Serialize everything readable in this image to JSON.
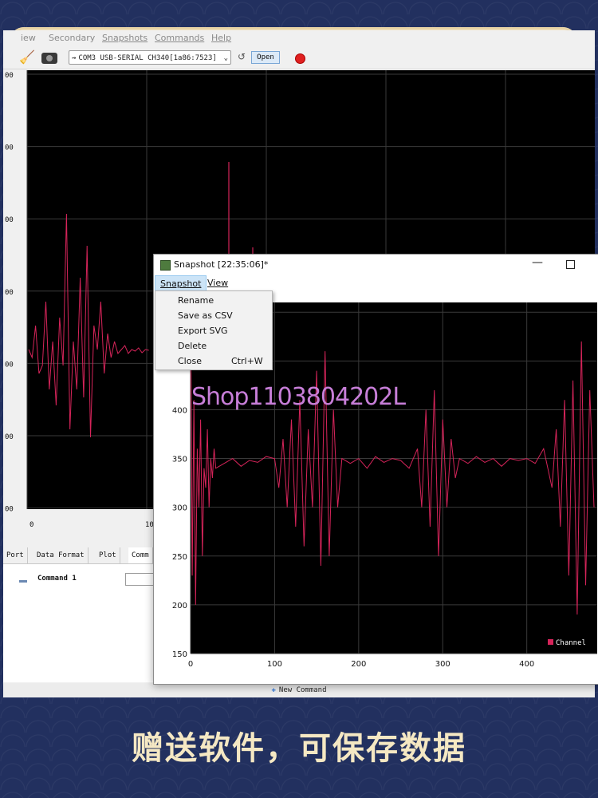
{
  "menubar": {
    "items": [
      "iew",
      "Secondary",
      "Snapshots",
      "Commands",
      "Help"
    ]
  },
  "toolbar": {
    "port": "COM3 USB-SERIAL CH340[1a86:7523]",
    "open_label": "Open",
    "icons": [
      "broom-icon",
      "camera-icon",
      "usb-icon",
      "reload-icon",
      "record-icon"
    ]
  },
  "tabs": [
    "Port",
    "Data Format",
    "Plot",
    "Comm"
  ],
  "command_panel": {
    "command_label": "Command 1",
    "new_command_label": "New Command"
  },
  "snapshot_window": {
    "title": "Snapshot [22:35:06]*",
    "menus": [
      "Snapshot",
      "View"
    ],
    "dropdown_items": [
      {
        "label": "Rename",
        "shortcut": ""
      },
      {
        "label": "Save as CSV",
        "shortcut": ""
      },
      {
        "label": "Export SVG",
        "shortcut": ""
      },
      {
        "label": "Delete",
        "shortcut": ""
      },
      {
        "label": "Close",
        "shortcut": "Ctrl+W"
      }
    ]
  },
  "watermark": "Shop1103804202L",
  "caption": "赠送软件，可保存数据",
  "colors": {
    "plot_bg": "#000000",
    "signal": "#d6245a",
    "grid": "#3a3a3a",
    "background": "#22305f",
    "caption": "#f5e8c3"
  },
  "chart_data": [
    {
      "type": "line",
      "title": "",
      "xlabel": "",
      "ylabel": "",
      "x_ticks": [
        "0",
        "10"
      ],
      "y_ticks": [
        "00",
        "00",
        "00",
        "00",
        "00",
        "00",
        "00"
      ],
      "grid": true,
      "series": [
        {
          "values": [
            350,
            340,
            380,
            320,
            330,
            410,
            300,
            360,
            280,
            390,
            330,
            520,
            250,
            360,
            300,
            440,
            290,
            480,
            240,
            380,
            350,
            410,
            320,
            370,
            340,
            360,
            345,
            350,
            355,
            345,
            350,
            348,
            352,
            346,
            350,
            349
          ]
        }
      ]
    },
    {
      "type": "line",
      "title": "",
      "xlabel": "",
      "ylabel": "",
      "x_ticks": [
        "0",
        "100",
        "200",
        "300",
        "400"
      ],
      "y_ticks": [
        "500",
        "450",
        "400",
        "350",
        "300",
        "250",
        "200",
        "150"
      ],
      "ylim": [
        150,
        510
      ],
      "xlim": [
        0,
        480
      ],
      "grid": true,
      "legend": "bottom-right",
      "series": [
        {
          "name": "Channel",
          "x": [
            0,
            2,
            4,
            6,
            8,
            10,
            12,
            14,
            16,
            18,
            20,
            22,
            24,
            26,
            28,
            30,
            40,
            50,
            60,
            70,
            80,
            90,
            100,
            105,
            110,
            115,
            120,
            125,
            130,
            135,
            140,
            145,
            150,
            155,
            160,
            165,
            170,
            175,
            180,
            190,
            200,
            210,
            220,
            230,
            240,
            250,
            260,
            270,
            275,
            280,
            285,
            290,
            295,
            300,
            305,
            310,
            315,
            320,
            330,
            340,
            350,
            360,
            370,
            380,
            390,
            400,
            410,
            420,
            430,
            435,
            440,
            445,
            450,
            455,
            460,
            465,
            470,
            475,
            480
          ],
          "values": [
            520,
            230,
            410,
            200,
            360,
            300,
            390,
            250,
            340,
            320,
            380,
            300,
            350,
            330,
            360,
            340,
            345,
            350,
            342,
            348,
            346,
            352,
            350,
            320,
            370,
            300,
            390,
            280,
            410,
            260,
            380,
            300,
            440,
            240,
            460,
            250,
            400,
            300,
            350,
            345,
            350,
            340,
            352,
            346,
            350,
            348,
            340,
            360,
            300,
            400,
            280,
            420,
            250,
            390,
            300,
            370,
            330,
            350,
            345,
            352,
            346,
            350,
            342,
            350,
            348,
            350,
            345,
            360,
            320,
            380,
            280,
            410,
            230,
            430,
            190,
            470,
            220,
            420,
            300
          ]
        }
      ]
    }
  ]
}
